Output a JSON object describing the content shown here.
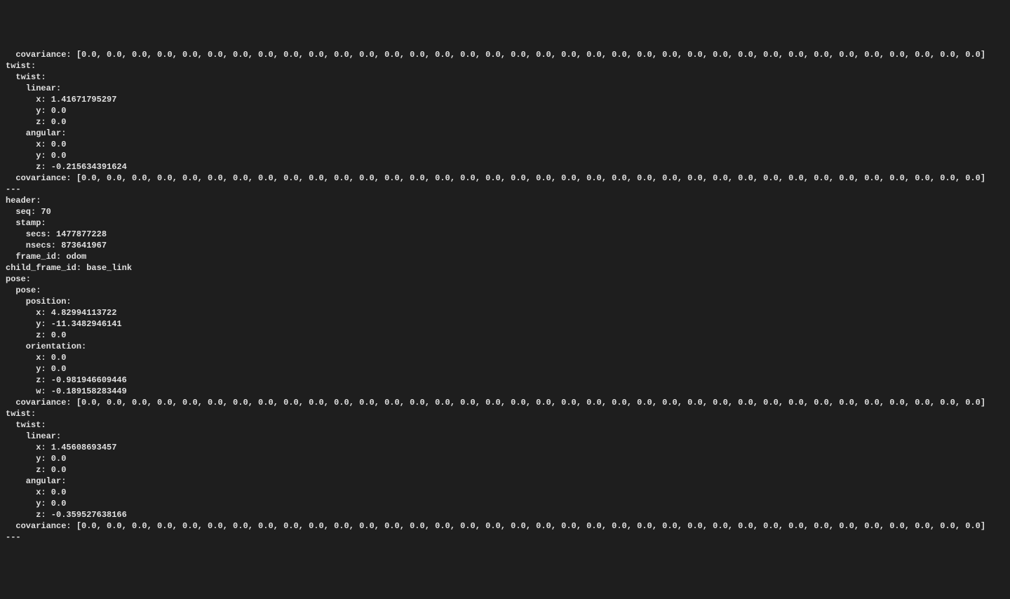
{
  "terminal": {
    "output": {
      "msg1_partial": {
        "covariance_line": "  covariance: [0.0, 0.0, 0.0, 0.0, 0.0, 0.0, 0.0, 0.0, 0.0, 0.0, 0.0, 0.0, 0.0, 0.0, 0.0, 0.0, 0.0, 0.0, 0.0, 0.0, 0.0, 0.0, 0.0, 0.0, 0.0, 0.0, 0.0, 0.0, 0.0, 0.0, 0.0, 0.0, 0.0, 0.0, 0.0, 0.0]",
        "twist_outer": "twist: ",
        "twist_inner": "  twist: ",
        "linear_label": "    linear: ",
        "linear_x": "      x: 1.41671795297",
        "linear_y": "      y: 0.0",
        "linear_z": "      z: 0.0",
        "angular_label": "    angular: ",
        "angular_x": "      x: 0.0",
        "angular_y": "      y: 0.0",
        "angular_z": "      z: -0.215634391624",
        "twist_covariance": "  covariance: [0.0, 0.0, 0.0, 0.0, 0.0, 0.0, 0.0, 0.0, 0.0, 0.0, 0.0, 0.0, 0.0, 0.0, 0.0, 0.0, 0.0, 0.0, 0.0, 0.0, 0.0, 0.0, 0.0, 0.0, 0.0, 0.0, 0.0, 0.0, 0.0, 0.0, 0.0, 0.0, 0.0, 0.0, 0.0, 0.0]"
      },
      "separator1": "---",
      "msg2": {
        "header_label": "header: ",
        "seq": "  seq: 70",
        "stamp_label": "  stamp: ",
        "secs": "    secs: 1477877228",
        "nsecs": "    nsecs: 873641967",
        "frame_id": "  frame_id: odom",
        "child_frame_id": "child_frame_id: base_link",
        "pose_outer": "pose: ",
        "pose_inner": "  pose: ",
        "position_label": "    position: ",
        "position_x": "      x: 4.82994113722",
        "position_y": "      y: -11.3482946141",
        "position_z": "      z: 0.0",
        "orientation_label": "    orientation: ",
        "orientation_x": "      x: 0.0",
        "orientation_y": "      y: 0.0",
        "orientation_z": "      z: -0.981946609446",
        "orientation_w": "      w: -0.189158283449",
        "pose_covariance": "  covariance: [0.0, 0.0, 0.0, 0.0, 0.0, 0.0, 0.0, 0.0, 0.0, 0.0, 0.0, 0.0, 0.0, 0.0, 0.0, 0.0, 0.0, 0.0, 0.0, 0.0, 0.0, 0.0, 0.0, 0.0, 0.0, 0.0, 0.0, 0.0, 0.0, 0.0, 0.0, 0.0, 0.0, 0.0, 0.0, 0.0]",
        "twist_outer": "twist: ",
        "twist_inner": "  twist: ",
        "linear_label": "    linear: ",
        "linear_x": "      x: 1.45608693457",
        "linear_y": "      y: 0.0",
        "linear_z": "      z: 0.0",
        "angular_label": "    angular: ",
        "angular_x": "      x: 0.0",
        "angular_y": "      y: 0.0",
        "angular_z": "      z: -0.359527638166",
        "twist_covariance": "  covariance: [0.0, 0.0, 0.0, 0.0, 0.0, 0.0, 0.0, 0.0, 0.0, 0.0, 0.0, 0.0, 0.0, 0.0, 0.0, 0.0, 0.0, 0.0, 0.0, 0.0, 0.0, 0.0, 0.0, 0.0, 0.0, 0.0, 0.0, 0.0, 0.0, 0.0, 0.0, 0.0, 0.0, 0.0, 0.0, 0.0]"
      },
      "separator2": "---"
    }
  }
}
